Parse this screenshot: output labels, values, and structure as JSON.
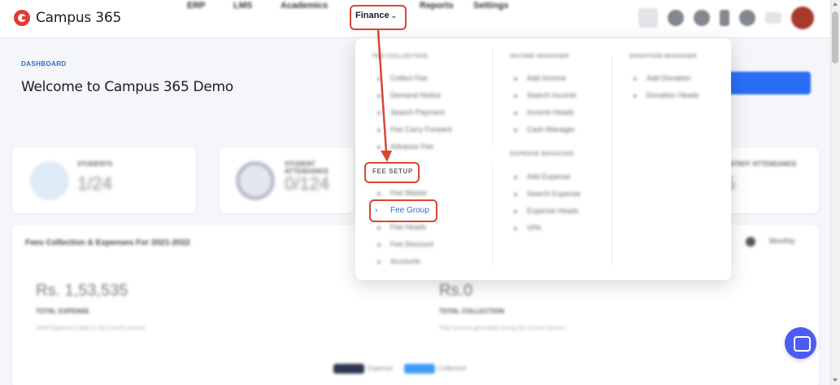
{
  "app": {
    "name": "Campus 365"
  },
  "nav": {
    "items": [
      "ERP",
      "LMS",
      "Academics",
      "Reports",
      "Settings"
    ],
    "finance_label": "Finance",
    "finance_chevron": "chevron-down-icon"
  },
  "header_icons": [
    "search-icon",
    "globe-icon",
    "notification-icon",
    "app-icon",
    "theme-icon",
    "grid-icon",
    "avatar"
  ],
  "page": {
    "breadcrumb": "DASHBOARD",
    "title": "Welcome to Campus 365 Demo"
  },
  "stats": [
    {
      "label": "STUDENTS",
      "value": "1/24"
    },
    {
      "label": "STUDENT ATTENDANCE",
      "value": "0/124"
    },
    {
      "label": "STAFF ATTENDANCE",
      "value": "5"
    }
  ],
  "finance_panel": {
    "title": "Fees Collection & Expenses For 2021-2022",
    "toggle": "Monthly",
    "expense": {
      "value": "Rs. 1,53,535",
      "label": "TOTAL EXPENSE",
      "note": "Total Expenses made in the current session"
    },
    "collection": {
      "value": "Rs.0",
      "label": "TOTAL COLLECTION",
      "note": "Total Income generated during the current session"
    },
    "legend": [
      {
        "name": "Expense",
        "color": "#2e3552"
      },
      {
        "name": "Collection",
        "color": "#3f9af5"
      }
    ]
  },
  "menu": {
    "columns": [
      {
        "heading": "FEE COLLECTION",
        "items": [
          "Collect Fee",
          "Demand Notice",
          "Search Payment",
          "Fee Carry Forward",
          "Advance Fee"
        ]
      },
      {
        "heading": "INCOME MANAGER",
        "items": [
          "Add Income",
          "Search Income",
          "Income Heads",
          "Cash Manager"
        ]
      },
      {
        "heading": "DONATION MANAGER",
        "items": [
          "Add Donation",
          "Donation Heads"
        ]
      }
    ],
    "fee_setup": {
      "heading": "FEE SETUP",
      "items": [
        "Fee Master",
        "Fee Group",
        "Fee Heads",
        "Fee Discount",
        "Accounts"
      ],
      "active": "Fee Group"
    },
    "expense_manager": {
      "heading": "EXPENSE MANAGER",
      "items": [
        "Add Expense",
        "Search Expense",
        "Expense Heads",
        "VPA"
      ]
    }
  },
  "colors": {
    "accent": "#2a6bd6",
    "annotation": "#d94634",
    "brand": "#e53935"
  }
}
